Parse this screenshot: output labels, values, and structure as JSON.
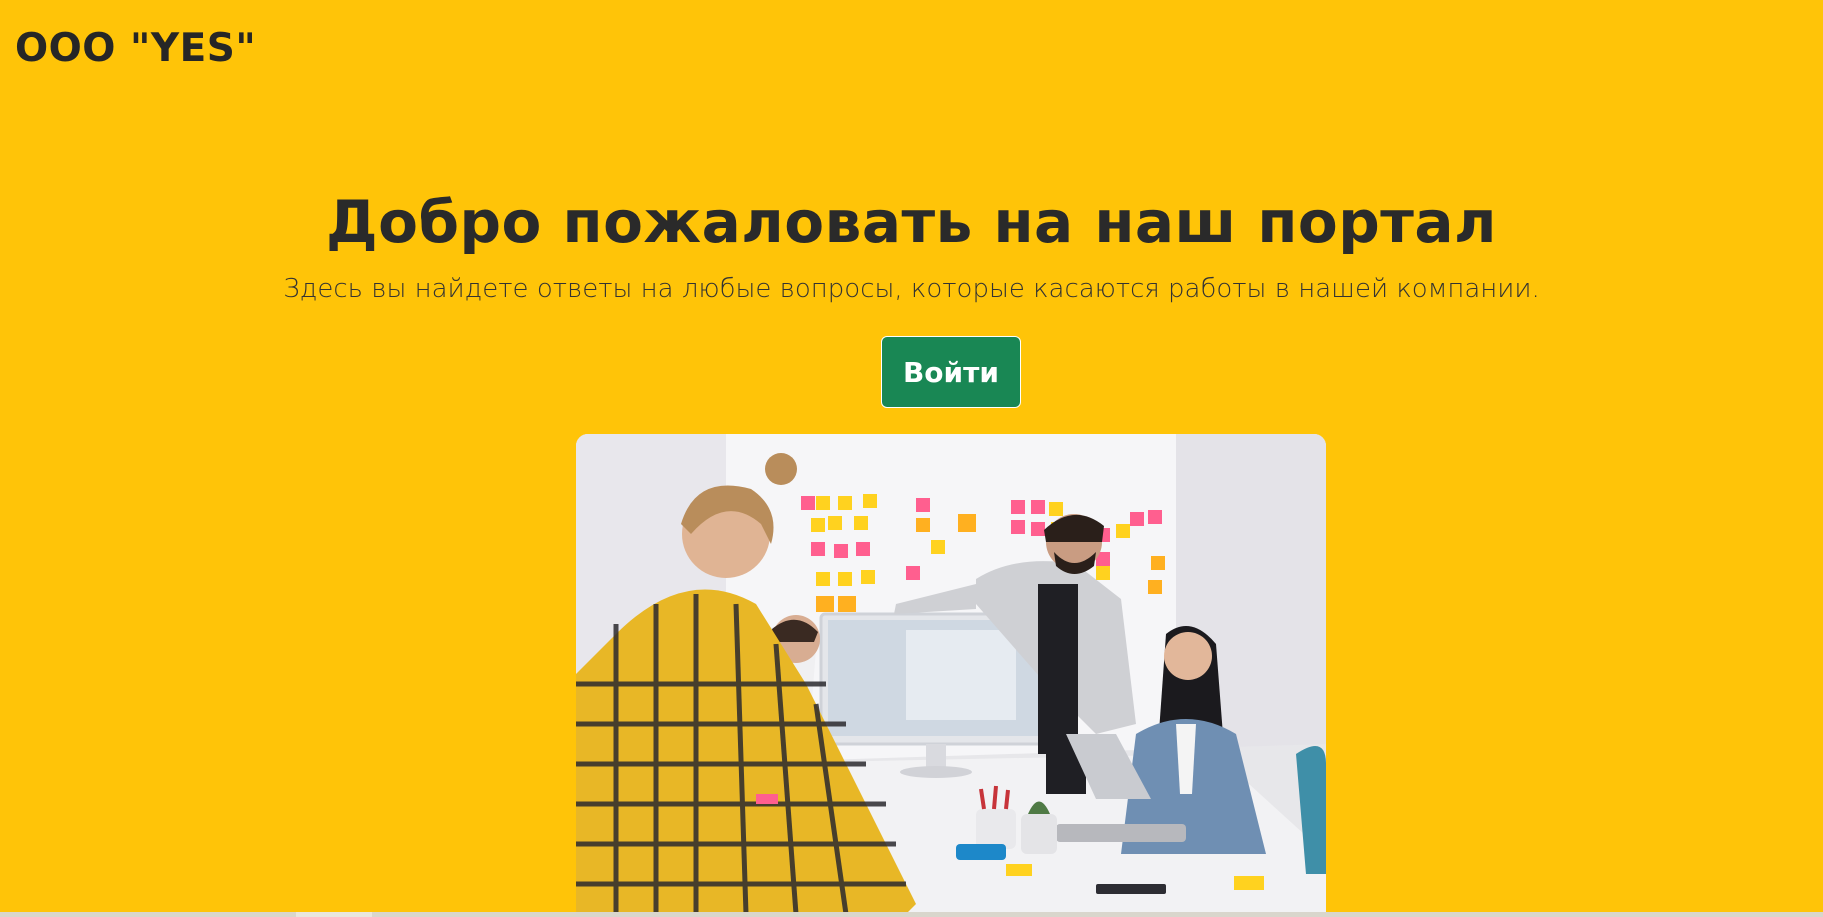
{
  "header": {
    "brand": "ООО \"YES\""
  },
  "hero": {
    "title": "Добро пожаловать на наш портал",
    "subtitle": "Здесь вы найдете ответы на любые вопросы, которые касаются работы в нашей компании.",
    "login_label": "Войти",
    "image_alt": "team-meeting-photo"
  },
  "colors": {
    "background": "#ffc408",
    "button": "#198754",
    "text": "#262626"
  }
}
